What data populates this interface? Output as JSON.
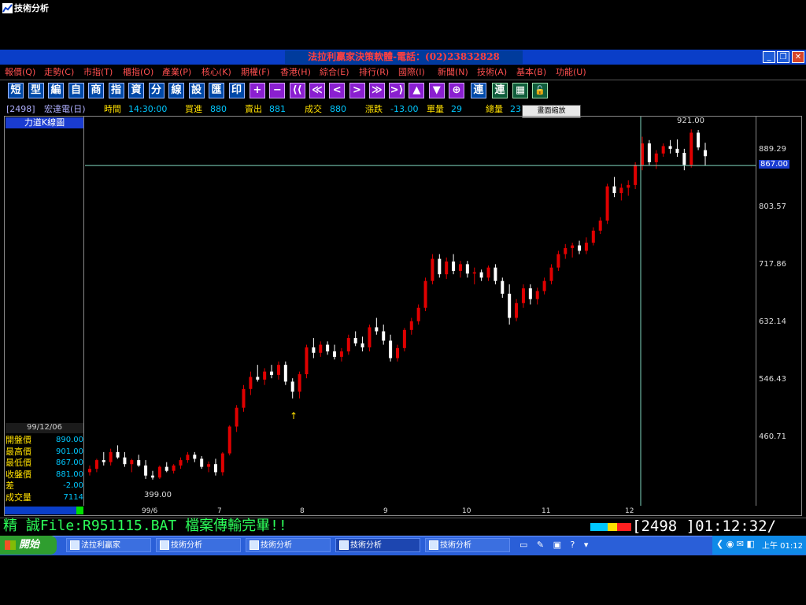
{
  "window": {
    "title": "技術分析",
    "center_banner": "法拉利贏家決策軟體-電話：(02)23832828"
  },
  "menu": [
    "報價(Q)",
    "走勢(C)",
    "市指(T)",
    "櫃指(O)",
    "產業(P)",
    "核心(K)",
    "期權(F)",
    "香港(H)",
    "綜合(E)",
    "排行(R)",
    "國際(I)",
    "新聞(N)",
    "技術(A)",
    "基本(B)",
    "功能(U)"
  ],
  "toolbar": {
    "text_buttons": [
      "短",
      "型",
      "編",
      "自",
      "商",
      "指",
      "資",
      "分",
      "線",
      "設",
      "匯",
      "印"
    ],
    "nav_buttons": [
      "+",
      "−",
      "⟨⟨",
      "≪",
      "<",
      ">",
      "≫",
      ">⟩",
      "▲",
      "▼",
      "⊕"
    ],
    "connect_button": "連",
    "connect_button_2": "連",
    "zoom_tooltip": "畫面縮放"
  },
  "quote": {
    "code": "[2498]",
    "name": "宏達電(日)",
    "time_label": "時間",
    "time": "14:30:00",
    "bid_label": "買進",
    "bid": "880",
    "ask_label": "賣出",
    "ask": "881",
    "trade_label": "成交",
    "trade": "880",
    "change_label": "漲跌",
    "change": "-13.00",
    "vol_label": "單量",
    "vol": "29",
    "total_label": "總量",
    "total": "23"
  },
  "chart": {
    "label": "力道K線圖",
    "price_labels": [
      "889.29",
      "803.57",
      "717.86",
      "632.14",
      "546.43",
      "460.71"
    ],
    "current_price": "867.00",
    "high_annotation": "921.00",
    "low_annotation": "399.00",
    "time_labels": [
      "99/6",
      "7",
      "8",
      "9",
      "10",
      "11",
      "12"
    ]
  },
  "info": {
    "date": "99/12/06",
    "rows": [
      {
        "k": "開盤價",
        "v": "890.00"
      },
      {
        "k": "最高價",
        "v": "901.00"
      },
      {
        "k": "最低價",
        "v": "867.00"
      },
      {
        "k": "收盤價",
        "v": "881.00"
      },
      {
        "k": "差",
        "v": "-2.00"
      },
      {
        "k": "成交量",
        "v": "7114"
      }
    ]
  },
  "status": {
    "left": "精 誠File:R951115.BAT 檔案傳輸完畢!!",
    "right": "[2498  ]01:12:32/"
  },
  "taskbar": {
    "start": "開始",
    "tasks": [
      "法拉利贏家",
      "技術分析",
      "技術分析",
      "技術分析",
      "技術分析"
    ],
    "clock": "上午 01:12"
  },
  "colors": {
    "up": "#e00000",
    "down": "#ffffff",
    "crosshair": "#7fd6c0"
  },
  "chart_data": {
    "type": "candlestick",
    "title": "力道K線圖",
    "y_axis_ticks": [
      460.71,
      546.43,
      632.14,
      717.86,
      803.57,
      889.29
    ],
    "ylim": [
      360,
      940
    ],
    "x_tick_labels": [
      "99/6",
      "7",
      "8",
      "9",
      "10",
      "11",
      "12"
    ],
    "annotations": {
      "high": 921.0,
      "low": 399.0,
      "crosshair_price": 867.0
    },
    "candles": [
      [
        410,
        420,
        405,
        415
      ],
      [
        415,
        430,
        410,
        428
      ],
      [
        428,
        440,
        420,
        425
      ],
      [
        425,
        445,
        420,
        440
      ],
      [
        440,
        450,
        430,
        432
      ],
      [
        432,
        440,
        418,
        422
      ],
      [
        422,
        430,
        410,
        428
      ],
      [
        428,
        436,
        418,
        420
      ],
      [
        420,
        428,
        400,
        405
      ],
      [
        405,
        412,
        399,
        402
      ],
      [
        402,
        420,
        400,
        418
      ],
      [
        418,
        425,
        410,
        412
      ],
      [
        412,
        422,
        408,
        420
      ],
      [
        420,
        432,
        415,
        428
      ],
      [
        428,
        440,
        424,
        436
      ],
      [
        436,
        440,
        425,
        430
      ],
      [
        430,
        434,
        415,
        418
      ],
      [
        418,
        426,
        410,
        422
      ],
      [
        422,
        430,
        405,
        410
      ],
      [
        410,
        440,
        405,
        438
      ],
      [
        438,
        480,
        435,
        478
      ],
      [
        478,
        510,
        470,
        506
      ],
      [
        506,
        540,
        500,
        534
      ],
      [
        534,
        560,
        525,
        552
      ],
      [
        552,
        570,
        545,
        548
      ],
      [
        548,
        565,
        540,
        560
      ],
      [
        560,
        570,
        550,
        555
      ],
      [
        555,
        575,
        548,
        570
      ],
      [
        570,
        575,
        540,
        545
      ],
      [
        545,
        550,
        520,
        530
      ],
      [
        530,
        560,
        520,
        556
      ],
      [
        556,
        600,
        550,
        596
      ],
      [
        596,
        610,
        580,
        588
      ],
      [
        588,
        605,
        582,
        600
      ],
      [
        600,
        605,
        585,
        590
      ],
      [
        590,
        600,
        578,
        582
      ],
      [
        582,
        595,
        575,
        590
      ],
      [
        590,
        615,
        585,
        610
      ],
      [
        610,
        620,
        598,
        602
      ],
      [
        602,
        612,
        590,
        596
      ],
      [
        596,
        630,
        590,
        626
      ],
      [
        626,
        640,
        615,
        620
      ],
      [
        620,
        630,
        600,
        606
      ],
      [
        606,
        615,
        575,
        580
      ],
      [
        580,
        600,
        575,
        595
      ],
      [
        595,
        625,
        590,
        622
      ],
      [
        622,
        640,
        615,
        635
      ],
      [
        635,
        660,
        630,
        655
      ],
      [
        655,
        700,
        650,
        695
      ],
      [
        695,
        735,
        690,
        728
      ],
      [
        728,
        735,
        700,
        705
      ],
      [
        705,
        730,
        698,
        724
      ],
      [
        724,
        735,
        705,
        710
      ],
      [
        710,
        725,
        700,
        720
      ],
      [
        720,
        725,
        700,
        706
      ],
      [
        706,
        715,
        690,
        708
      ],
      [
        708,
        712,
        695,
        700
      ],
      [
        700,
        718,
        695,
        715
      ],
      [
        715,
        720,
        690,
        695
      ],
      [
        695,
        700,
        670,
        676
      ],
      [
        676,
        690,
        630,
        640
      ],
      [
        640,
        668,
        635,
        662
      ],
      [
        662,
        690,
        655,
        684
      ],
      [
        684,
        690,
        660,
        668
      ],
      [
        668,
        685,
        660,
        680
      ],
      [
        680,
        700,
        675,
        695
      ],
      [
        695,
        720,
        690,
        715
      ],
      [
        715,
        740,
        710,
        735
      ],
      [
        735,
        750,
        728,
        744
      ],
      [
        744,
        752,
        730,
        748
      ],
      [
        748,
        755,
        735,
        740
      ],
      [
        740,
        760,
        735,
        752
      ],
      [
        752,
        775,
        748,
        770
      ],
      [
        770,
        790,
        765,
        785
      ],
      [
        785,
        840,
        780,
        836
      ],
      [
        836,
        850,
        820,
        826
      ],
      [
        826,
        840,
        815,
        834
      ],
      [
        834,
        845,
        822,
        838
      ],
      [
        838,
        872,
        832,
        868
      ],
      [
        868,
        910,
        860,
        900
      ],
      [
        900,
        905,
        868,
        872
      ],
      [
        872,
        890,
        862,
        885
      ],
      [
        885,
        900,
        880,
        896
      ],
      [
        896,
        905,
        885,
        892
      ],
      [
        892,
        906,
        880,
        886
      ],
      [
        886,
        892,
        860,
        868
      ],
      [
        868,
        921,
        864,
        916
      ],
      [
        916,
        920,
        890,
        894
      ],
      [
        890,
        901,
        867,
        881
      ]
    ]
  }
}
